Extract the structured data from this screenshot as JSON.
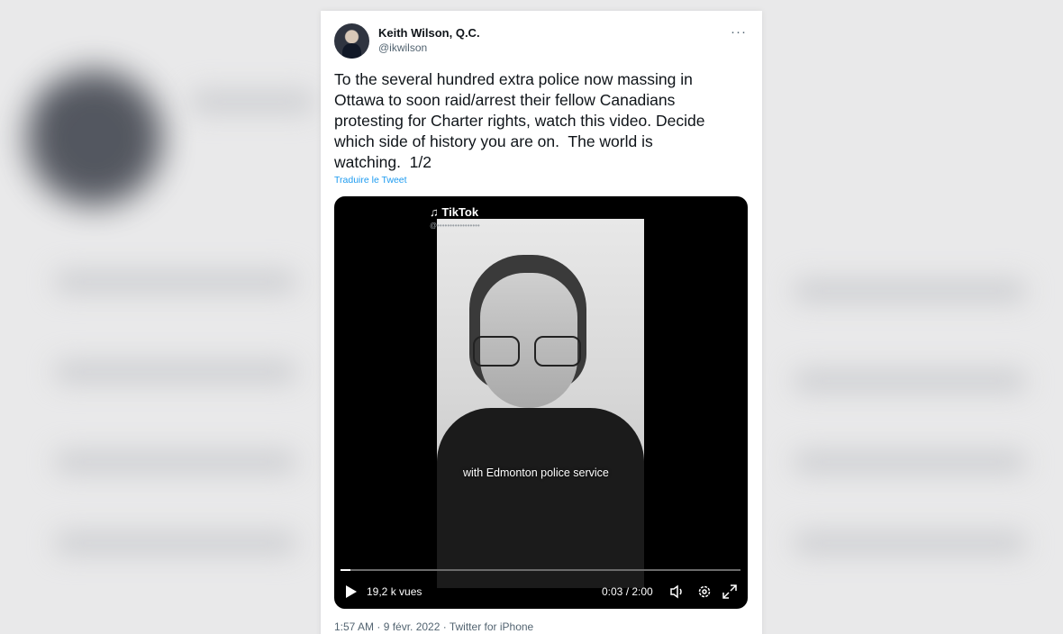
{
  "tweet": {
    "author_name": "Keith Wilson, Q.C.",
    "author_handle": "@ikwilson",
    "more_label": "···",
    "text": "To the several hundred extra police now massing in\nOttawa to soon raid/arrest their fellow Canadians\nprotesting for Charter rights, watch this video. Decide\nwhich side of history you are on.  The world is\nwatching.  1/2",
    "translate_link": "Traduire le Tweet",
    "timestamp_line": "1:57 AM · 9 févr. 2022 · Twitter for iPhone"
  },
  "video": {
    "watermark": "TikTok",
    "caption": "with Edmonton police service",
    "views": "19,2 k vues",
    "time": "0:03 / 2:00",
    "progress": 0.025
  },
  "icons": [
    "more-icon",
    "play-icon",
    "volume-icon",
    "settings-icon",
    "fullscreen-icon",
    "tiktok-icon"
  ],
  "colors": {
    "link": "#1d9bf0",
    "text": "#0f1419",
    "muted": "#536471"
  }
}
